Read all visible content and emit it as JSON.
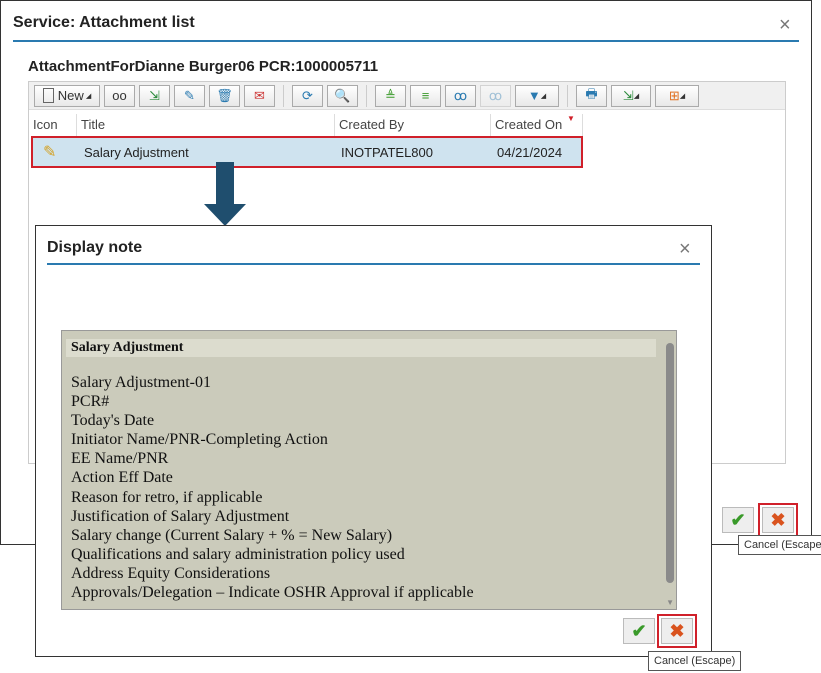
{
  "outer": {
    "title": "Service: Attachment list",
    "subtitle": "AttachmentForDianne Burger06 PCR:1000005711",
    "close": "×",
    "toolbar": {
      "new_label": "New"
    },
    "columns": [
      "Icon",
      "Title",
      "Created By",
      "Created On"
    ],
    "rows": [
      {
        "icon": "note-icon",
        "title": "Salary Adjustment",
        "created_by": "INOTPATEL800",
        "created_on": "04/21/2024"
      }
    ],
    "ok": "✔",
    "cancel": "✖",
    "tooltip": "Cancel (Escape)"
  },
  "inner": {
    "title": "Display note",
    "close": "×",
    "heading": "Salary Adjustment",
    "lines": [
      "Salary Adjustment-01",
      "PCR#",
      "Today's Date",
      "Initiator Name/PNR-Completing Action",
      "EE Name/PNR",
      "Action Eff Date",
      "Reason for retro, if applicable",
      "Justification of Salary Adjustment",
      "Salary change (Current Salary + % = New Salary)",
      "Qualifications and salary administration policy used",
      "Address Equity Considerations",
      "Approvals/Delegation – Indicate OSHR Approval if applicable"
    ],
    "ok": "✔",
    "cancel": "✖",
    "tooltip": "Cancel (Escape)"
  },
  "colors": {
    "accent": "#2a7ab0",
    "highlight": "#d0202a",
    "arrow": "#1f4e6e",
    "note_bg": "#cbcbbb"
  }
}
